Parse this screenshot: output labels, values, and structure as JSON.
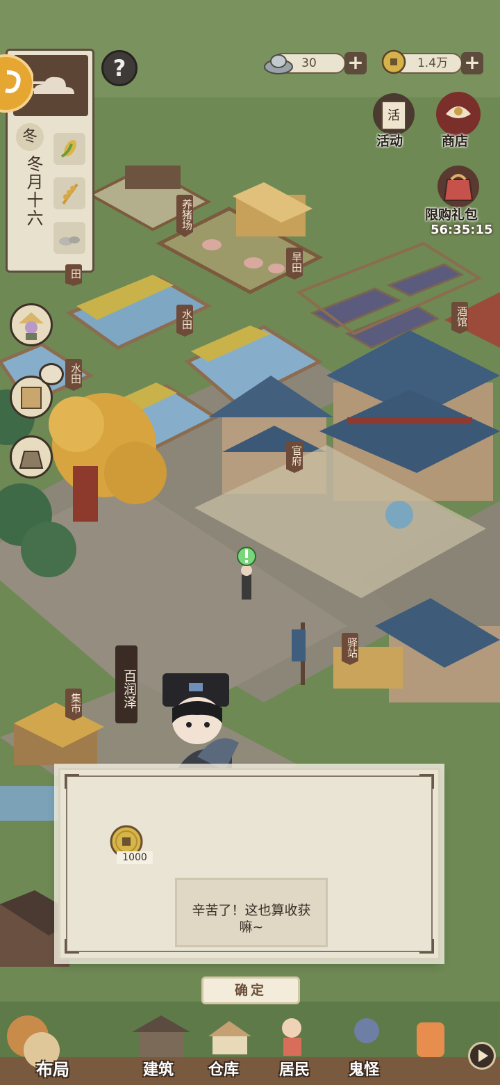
{
  "resources": {
    "ingot": {
      "value": "30",
      "icon": "silver-ingot-icon"
    },
    "coin": {
      "value": "1.4万",
      "icon": "copper-coin-icon"
    },
    "add_label": "+"
  },
  "help": {
    "label": "?"
  },
  "season": {
    "tag": "冬",
    "date": "冬月十六"
  },
  "top_right": {
    "activity": "活动",
    "activity_icon_text": "活",
    "shop": "商店",
    "gift": "限购礼包",
    "gift_timer": "56:35:15"
  },
  "map_labels": {
    "pig_farm": "养猪场",
    "dry_field": "旱田",
    "paddy_1": "田",
    "paddy_2": "水田",
    "paddy_3": "水田",
    "tavern": "酒馆",
    "government": "官府",
    "post_station": "驿站",
    "market": "集市",
    "npc_name": "百润泽"
  },
  "dialog": {
    "reward_amount": "1000",
    "message": "辛苦了！这也算收获嘛~",
    "confirm": "确定"
  },
  "bottom_nav": {
    "layout": "布局",
    "build": "建筑",
    "warehouse": "仓库",
    "residents": "居民",
    "spirits": "鬼怪"
  },
  "colors": {
    "grass": "#6f8a55",
    "panel": "#e8e1cd",
    "wood": "#6e4a38",
    "dialog_bg": "#e9e4d4"
  }
}
